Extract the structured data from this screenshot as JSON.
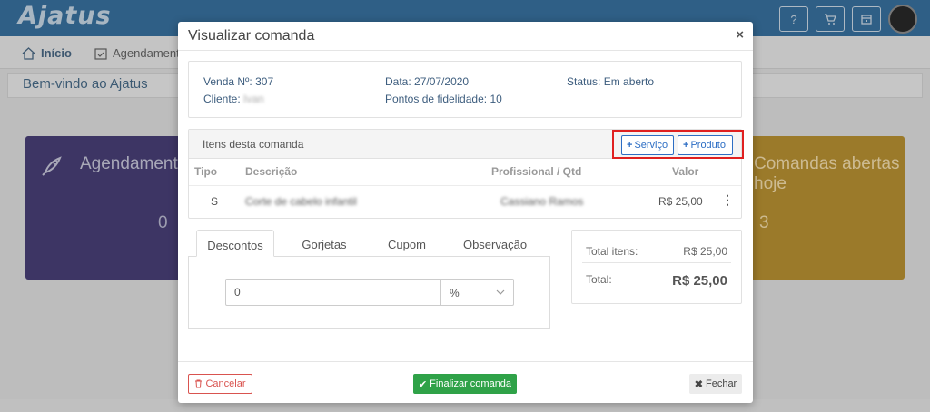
{
  "app": {
    "logo": "Ajatus",
    "top_icons": [
      "question-icon",
      "cart-icon",
      "calendar-icon"
    ],
    "nav": {
      "home_label": "Início",
      "schedule_label": "Agendamentos"
    },
    "welcome": "Bem-vindo ao Ajatus",
    "cards": [
      {
        "title": "Agendamentos",
        "count": "0",
        "color": "#3d3564"
      },
      {
        "title": "Comandas abertas hoje",
        "count": "3",
        "color": "#9b7a2a"
      }
    ]
  },
  "modal": {
    "title": "Visualizar comanda",
    "close": "×",
    "info": {
      "sale_label": "Venda Nº:",
      "sale_value": "307",
      "client_label": "Cliente:",
      "client_value": "Ivan",
      "date_label": "Data:",
      "date_value": "27/07/2020",
      "points_label": "Pontos de fidelidade:",
      "points_value": "10",
      "status_label": "Status:",
      "status_value": "Em aberto"
    },
    "items": {
      "title": "Itens desta comanda",
      "add_service": "Serviço",
      "add_product": "Produto",
      "columns": {
        "type": "Tipo",
        "description": "Descrição",
        "professional": "Profissional / Qtd",
        "value": "Valor"
      },
      "rows": [
        {
          "type": "S",
          "description": "Corte de cabelo infantil",
          "professional": "Cassiano Ramos",
          "value": "R$ 25,00"
        }
      ]
    },
    "tabs": [
      "Descontos",
      "Gorjetas",
      "Cupom",
      "Observação"
    ],
    "discount": {
      "value": "0",
      "unit": "%"
    },
    "totals": {
      "items_label": "Total itens:",
      "items_value": "R$ 25,00",
      "total_label": "Total:",
      "total_value": "R$ 25,00"
    },
    "footer": {
      "cancel": "Cancelar",
      "finalize": "Finalizar comanda",
      "close": "Fechar"
    }
  },
  "colors": {
    "accent": "#2d6ec4",
    "success": "#2fa248",
    "danger": "#d9534f",
    "highlight": "#e02020"
  }
}
